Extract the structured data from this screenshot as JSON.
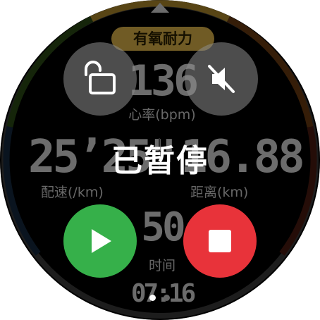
{
  "workout": {
    "zone_label": "有氧耐力",
    "heart_rate": {
      "value": "136",
      "label": "心率(bpm)"
    },
    "pace": {
      "value": "25’25\"",
      "label": "配速(/km)"
    },
    "distance": {
      "value": "16.88",
      "label": "距离(km)"
    },
    "duration": {
      "value": "50",
      "label": "时间"
    },
    "clock": {
      "value": "07:16"
    }
  },
  "overlay": {
    "status_text": "已暂停",
    "lock_icon": "unlock-icon",
    "mute_icon": "mute-icon",
    "resume_icon": "play-icon",
    "stop_icon": "stop-icon"
  },
  "pager": {
    "active_index": 0,
    "count": 2
  },
  "colors": {
    "zone_gold": "#e0b64a",
    "resume_green": "#36b04a",
    "stop_red": "#e8333a"
  }
}
